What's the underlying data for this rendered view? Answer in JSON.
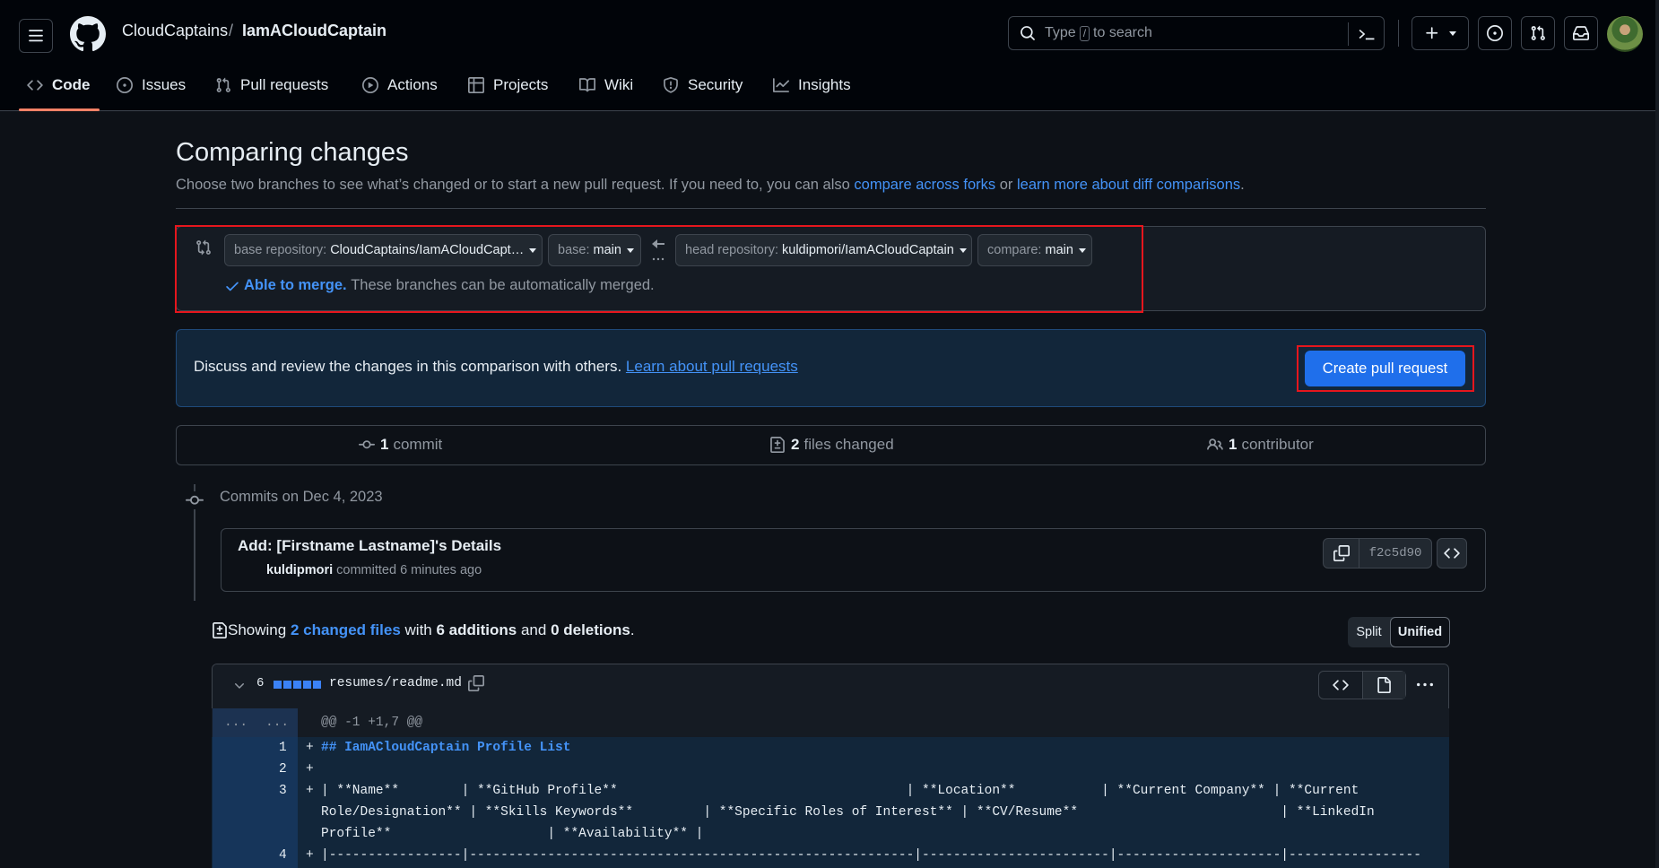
{
  "header": {
    "owner": "CloudCaptains",
    "separator": "/",
    "repo": "IamACloudCaptain",
    "search_prefix": "Type",
    "search_key": "/",
    "search_suffix": "to search"
  },
  "tabs": [
    {
      "label": "Code"
    },
    {
      "label": "Issues"
    },
    {
      "label": "Pull requests"
    },
    {
      "label": "Actions"
    },
    {
      "label": "Projects"
    },
    {
      "label": "Wiki"
    },
    {
      "label": "Security"
    },
    {
      "label": "Insights"
    }
  ],
  "compare": {
    "title": "Comparing changes",
    "desc_text": "Choose two branches to see what’s changed or to start a new pull request. If you need to, you can also",
    "link_forks": "compare across forks",
    "or_text": "or",
    "link_learn_diff": "learn more about diff comparisons",
    "period": ".",
    "base_repo_label": "base repository:",
    "base_repo_value": "CloudCaptains/IamACloudCapt…",
    "base_label": "base:",
    "base_value": "main",
    "head_repo_label": "head repository:",
    "head_repo_value": "kuldipmori/IamACloudCaptain",
    "compare_label": "compare:",
    "compare_value": "main",
    "merge_status": "Able to merge.",
    "merge_note": "These branches can be automatically merged."
  },
  "pr_box": {
    "text": "Discuss and review the changes in this comparison with others.",
    "link": "Learn about pull requests",
    "button": "Create pull request"
  },
  "stats": {
    "commits_count": "1",
    "commits_label": "commit",
    "files_count": "2",
    "files_label": "files changed",
    "contrib_count": "1",
    "contrib_label": "contributor"
  },
  "commits": {
    "date_heading": "Commits on Dec 4, 2023",
    "title": "Add: [Firstname Lastname]'s Details",
    "author": "kuldipmori",
    "meta": "committed 6 minutes ago",
    "sha": "f2c5d90"
  },
  "summary": {
    "showing": "Showing",
    "files_link": "2 changed files",
    "with": "with",
    "additions": "6 additions",
    "and": "and",
    "deletions": "0 deletions",
    "period": ".",
    "split": "Split",
    "unified": "Unified"
  },
  "file": {
    "count": "6",
    "path": "resumes/readme.md",
    "hunk_left": "...",
    "hunk_right": "...",
    "hunk_header": "@@ -1 +1,7 @@",
    "lines": [
      {
        "num": "1",
        "sign": "+",
        "text": "## IamACloudCaptain Profile List"
      },
      {
        "num": "2",
        "sign": "+",
        "text": ""
      },
      {
        "num": "3",
        "sign": "+",
        "text": "| **Name**        | **GitHub Profile**                                     | **Location**           | **Current Company** | **Current",
        "cont1": "Role/Designation** | **Skills Keywords**         | **Specific Roles of Interest** | **CV/Resume**                          | **LinkedIn",
        "cont2": "Profile**                    | **Availability** |"
      },
      {
        "num": "4",
        "sign": "+",
        "text": "|-----------------|---------------------------------------------------------|------------------------|---------------------|-----------------"
      }
    ]
  },
  "colors": {
    "accent": "#4493f8",
    "button": "#1f6feb",
    "highlight_box": "#e5161d",
    "add_bg": "#12263a"
  }
}
